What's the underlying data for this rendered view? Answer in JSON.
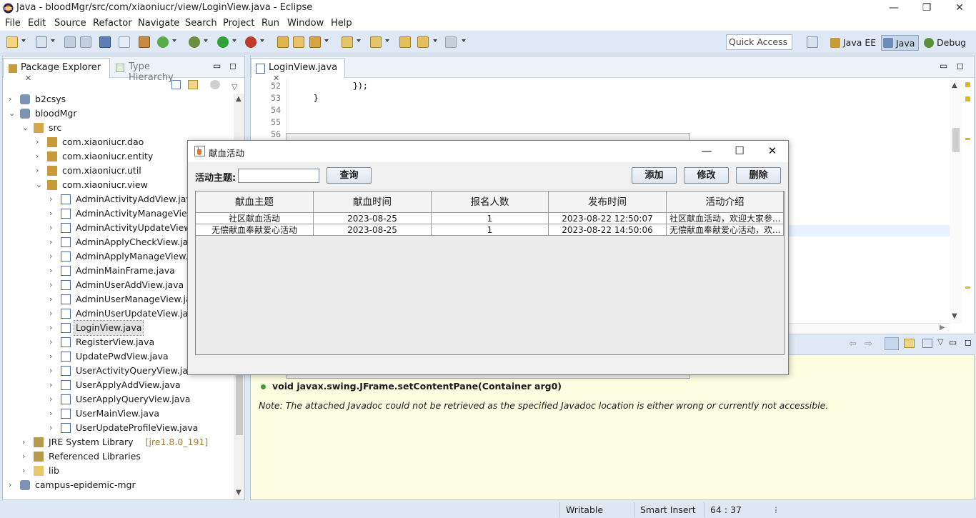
{
  "window": {
    "title": "Java - bloodMgr/src/com/xiaoniucr/view/LoginView.java - Eclipse"
  },
  "menu": [
    "File",
    "Edit",
    "Source",
    "Refactor",
    "Navigate",
    "Search",
    "Project",
    "Run",
    "Window",
    "Help"
  ],
  "toolbar": {
    "quick_access": "Quick Access"
  },
  "perspectives": [
    "Java EE",
    "Java",
    "Debug"
  ],
  "package_explorer": {
    "tab": "Package Explorer",
    "tab2": "Type Hierarchy",
    "tree": [
      {
        "label": "b2csys",
        "depth": 0,
        "expanded": false,
        "icon": "project-icon"
      },
      {
        "label": "bloodMgr",
        "depth": 0,
        "expanded": true,
        "icon": "project-icon"
      },
      {
        "label": "src",
        "depth": 1,
        "expanded": true,
        "icon": "source-folder-icon"
      },
      {
        "label": "com.xiaoniucr.dao",
        "depth": 2,
        "expanded": false,
        "icon": "package-icon"
      },
      {
        "label": "com.xiaoniucr.entity",
        "depth": 2,
        "expanded": false,
        "icon": "package-icon"
      },
      {
        "label": "com.xiaoniucr.util",
        "depth": 2,
        "expanded": false,
        "icon": "package-icon"
      },
      {
        "label": "com.xiaoniucr.view",
        "depth": 2,
        "expanded": true,
        "icon": "package-icon"
      },
      {
        "label": "AdminActivityAddView.java",
        "depth": 3,
        "expanded": false,
        "icon": "java-file-icon"
      },
      {
        "label": "AdminActivityManageView.java",
        "depth": 3,
        "expanded": false,
        "icon": "java-file-icon"
      },
      {
        "label": "AdminActivityUpdateView.java",
        "depth": 3,
        "expanded": false,
        "icon": "java-file-icon"
      },
      {
        "label": "AdminApplyCheckView.java",
        "depth": 3,
        "expanded": false,
        "icon": "java-file-icon"
      },
      {
        "label": "AdminApplyManageView.java",
        "depth": 3,
        "expanded": false,
        "icon": "java-file-icon"
      },
      {
        "label": "AdminMainFrame.java",
        "depth": 3,
        "expanded": false,
        "icon": "java-file-icon"
      },
      {
        "label": "AdminUserAddView.java",
        "depth": 3,
        "expanded": false,
        "icon": "java-file-icon"
      },
      {
        "label": "AdminUserManageView.java",
        "depth": 3,
        "expanded": false,
        "icon": "java-file-icon"
      },
      {
        "label": "AdminUserUpdateView.java",
        "depth": 3,
        "expanded": false,
        "icon": "java-file-icon"
      },
      {
        "label": "LoginView.java",
        "depth": 3,
        "expanded": false,
        "icon": "java-file-icon",
        "selected": true
      },
      {
        "label": "RegisterView.java",
        "depth": 3,
        "expanded": false,
        "icon": "java-file-icon"
      },
      {
        "label": "UpdatePwdView.java",
        "depth": 3,
        "expanded": false,
        "icon": "java-file-icon"
      },
      {
        "label": "UserActivityQueryView.java",
        "depth": 3,
        "expanded": false,
        "icon": "java-file-icon"
      },
      {
        "label": "UserApplyAddView.java",
        "depth": 3,
        "expanded": false,
        "icon": "java-file-icon"
      },
      {
        "label": "UserApplyQueryView.java",
        "depth": 3,
        "expanded": false,
        "icon": "java-file-icon"
      },
      {
        "label": "UserMainView.java",
        "depth": 3,
        "expanded": false,
        "icon": "java-file-icon"
      },
      {
        "label": "UserUpdateProfileView.java",
        "depth": 3,
        "expanded": false,
        "icon": "java-file-icon"
      },
      {
        "label": "JRE System Library",
        "suffix": "[jre1.8.0_191]",
        "depth": 1,
        "expanded": false,
        "icon": "library-icon"
      },
      {
        "label": "Referenced Libraries",
        "depth": 1,
        "expanded": false,
        "icon": "library-icon"
      },
      {
        "label": "lib",
        "depth": 1,
        "expanded": false,
        "icon": "folder-icon"
      },
      {
        "label": "campus-epidemic-mgr",
        "depth": 0,
        "expanded": false,
        "icon": "project-icon"
      }
    ]
  },
  "editor": {
    "tab": "LoginView.java",
    "lines": [
      {
        "no": "52",
        "code": "            });"
      },
      {
        "no": "53",
        "code": "    }"
      },
      {
        "no": "54",
        "code": ""
      },
      {
        "no": "55",
        "code": ""
      },
      {
        "no": "56",
        "code": ""
      }
    ]
  },
  "javadoc": {
    "signature": "void javax.swing.JFrame.setContentPane(Container arg0)",
    "note": "Note: The attached Javadoc could not be retrieved as the specified Javadoc location is either wrong or currently not accessible."
  },
  "status": {
    "writable": "Writable",
    "insert": "Smart Insert",
    "position": "64 : 37"
  },
  "dialog": {
    "title": "献血活动",
    "topic_label": "活动主题:",
    "topic_value": "",
    "query_btn": "查询",
    "add_btn": "添加",
    "edit_btn": "修改",
    "delete_btn": "删除",
    "columns": [
      "献血主题",
      "献血时间",
      "报名人数",
      "发布时间",
      "活动介绍"
    ],
    "rows": [
      [
        "社区献血活动",
        "2023-08-25",
        "1",
        "2023-08-22 12:50:07",
        "社区献血活动，欢迎大家参..."
      ],
      [
        "无偿献血奉献爱心活动",
        "2023-08-25",
        "1",
        "2023-08-22 14:50:06",
        "无偿献血奉献爱心活动，欢..."
      ]
    ]
  },
  "colors": {
    "accent": "#dfe9f5",
    "selection": "#e3e3e3",
    "javadoc_bg": "#fdfde1"
  }
}
